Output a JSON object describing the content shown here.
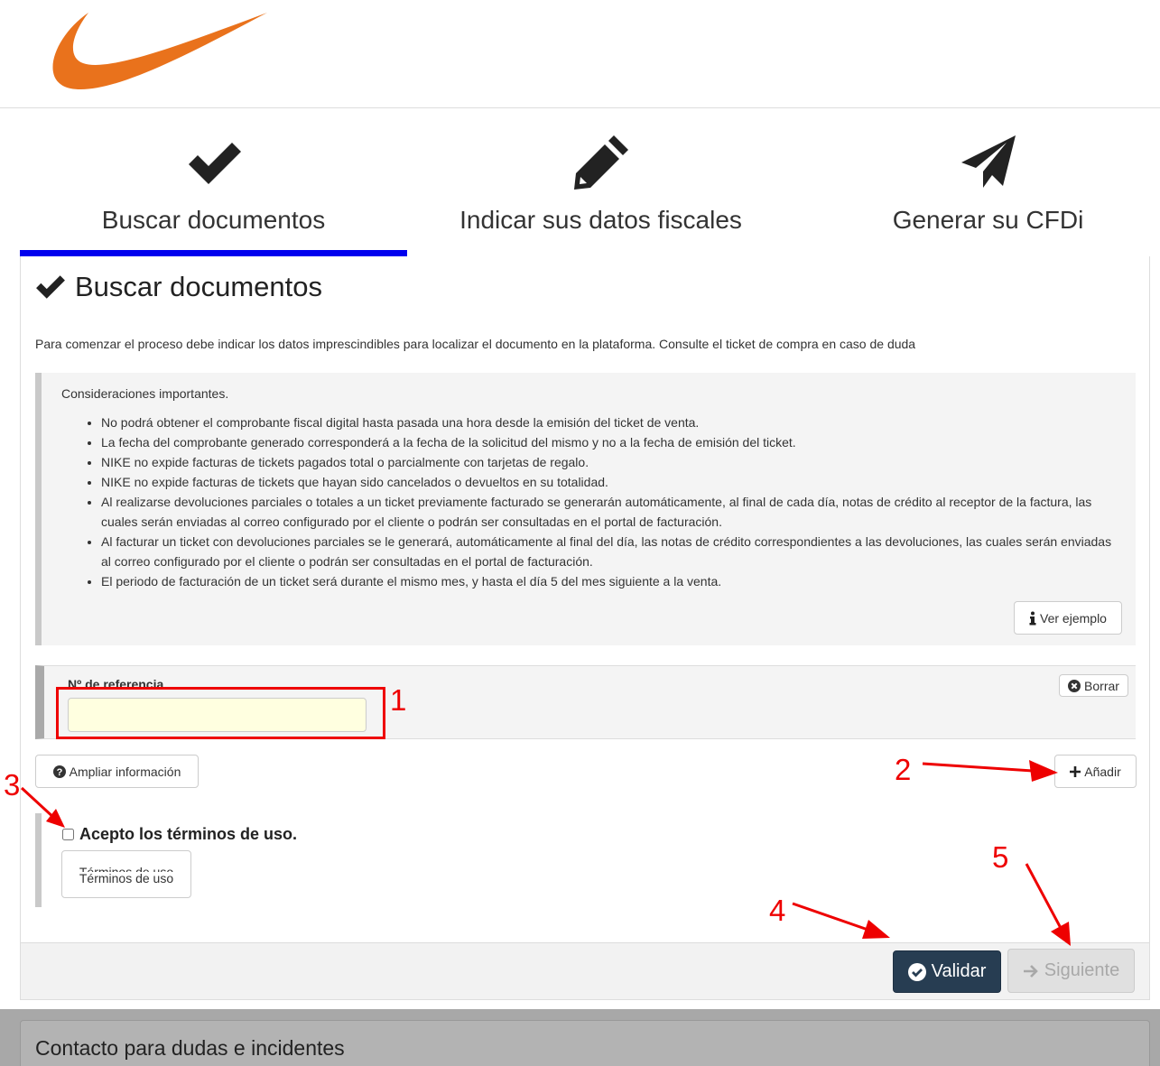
{
  "brand": {
    "logo_color": "#e9721c"
  },
  "steps": [
    {
      "label": "Buscar documentos",
      "icon": "check-icon",
      "active": true
    },
    {
      "label": "Indicar sus datos fiscales",
      "icon": "pencil-icon",
      "active": false
    },
    {
      "label": "Generar su CFDi",
      "icon": "paper-plane-icon",
      "active": false
    }
  ],
  "card": {
    "title": "Buscar documentos",
    "intro": "Para comenzar el proceso debe indicar los datos imprescindibles para localizar el documento en la plataforma. Consulte el ticket de compra en caso de duda"
  },
  "notes": {
    "title": "Consideraciones importantes.",
    "items": [
      "No podrá obtener el comprobante fiscal digital hasta pasada una hora desde la emisión del ticket de venta.",
      "La fecha del comprobante generado corresponderá a la fecha de la solicitud del mismo y no a la fecha de emisión del ticket.",
      "NIKE no expide facturas de tickets pagados total o parcialmente con tarjetas de regalo.",
      "NIKE no expide facturas de tickets que hayan sido cancelados o devueltos en su totalidad.",
      "Al realizarse devoluciones parciales o totales a un ticket previamente facturado se generarán automáticamente, al final de cada día, notas de crédito al receptor de la factura, las cuales serán enviadas al correo configurado por el cliente o podrán ser consultadas en el portal de facturación.",
      "Al facturar un ticket con devoluciones parciales se le generará, automáticamente al final del día, las notas de crédito correspondientes a las devoluciones, las cuales serán enviadas al correo configurado por el cliente o podrán ser consultadas en el portal de facturación.",
      "El periodo de facturación de un ticket será durante el mismo mes, y hasta el día 5 del mes siguiente a la venta."
    ],
    "example_button": "Ver ejemplo"
  },
  "reference": {
    "label": "Nº de referencia",
    "value": "",
    "clear_button": "Borrar"
  },
  "actions": {
    "more_info": "Ampliar información",
    "add": "Añadir"
  },
  "terms": {
    "accept_label": "Acepto los términos de uso.",
    "checked": false,
    "button_label_overlap": "Términos de uso",
    "button_label": "Términos de uso"
  },
  "footer": {
    "validate": "Validar",
    "next": "Siguiente"
  },
  "contact": {
    "title": "Contacto para dudas e incidentes"
  },
  "annotations": {
    "color": "#ee0000",
    "labels": [
      "1",
      "2",
      "3",
      "4",
      "5"
    ]
  },
  "colors": {
    "active_step_bar": "#0000ee",
    "validate_bg": "#273d52",
    "input_bg": "#ffffe0"
  }
}
